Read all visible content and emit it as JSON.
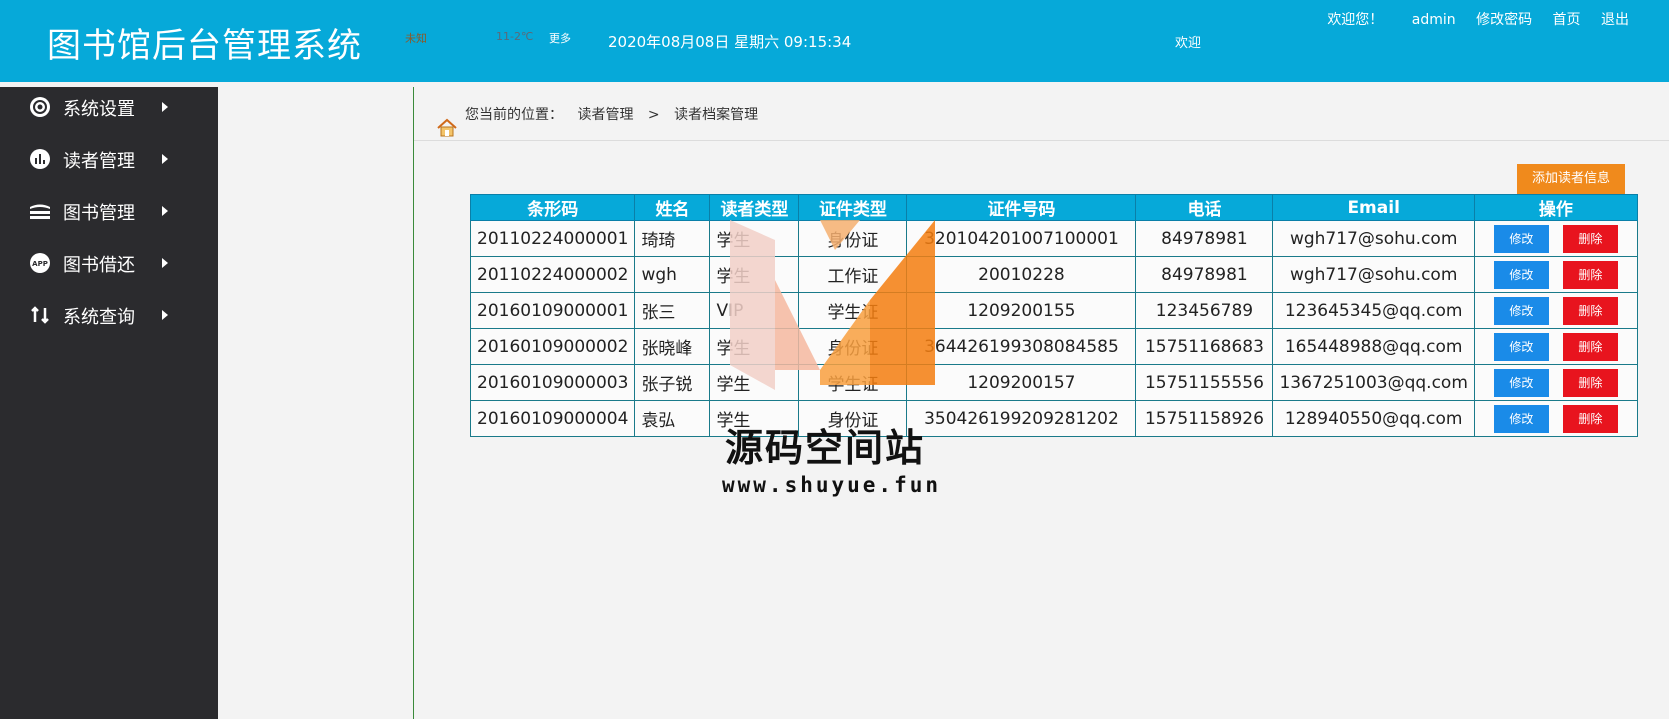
{
  "header": {
    "title": "图书馆后台管理系统",
    "weather": "未知",
    "temperature": "11-2℃",
    "more": "更多",
    "datetime": "2020年08月08日 星期六 09:15:34",
    "mid_text": "欢迎",
    "welcome": "欢迎您！",
    "user": "admin",
    "change_password": "修改密码",
    "home": "首页",
    "logout": "退出"
  },
  "sidebar": {
    "items": [
      {
        "label": "系统设置",
        "icon": "gear-icon"
      },
      {
        "label": "读者管理",
        "icon": "chart-icon"
      },
      {
        "label": "图书管理",
        "icon": "stack-icon"
      },
      {
        "label": "图书借还",
        "icon": "app-icon"
      },
      {
        "label": "系统查询",
        "icon": "swap-icon"
      }
    ]
  },
  "breadcrumb": {
    "prefix": "您当前的位置：",
    "level1": "读者管理",
    "sep": ">",
    "level2": "读者档案管理"
  },
  "add_button": "添加读者信息",
  "table": {
    "headers": [
      "条形码",
      "姓名",
      "读者类型",
      "证件类型",
      "证件号码",
      "电话",
      "Email",
      "操作"
    ],
    "edit_label": "修改",
    "delete_label": "删除",
    "rows": [
      [
        "20110224000001",
        "琦琦",
        "学生",
        "身份证",
        "320104201007100001",
        "84978981",
        "wgh717@sohu.com"
      ],
      [
        "20110224000002",
        "wgh",
        "学生",
        "工作证",
        "20010228",
        "84978981",
        "wgh717@sohu.com"
      ],
      [
        "20160109000001",
        "张三",
        "VIP",
        "学生证",
        "1209200155",
        "123456789",
        "123645345@qq.com"
      ],
      [
        "20160109000002",
        "张晓峰",
        "学生",
        "身份证",
        "364426199308084585",
        "15751168683",
        "165448988@qq.com"
      ],
      [
        "20160109000003",
        "张子锐",
        "学生",
        "学生证",
        "1209200157",
        "15751155556",
        "1367251003@qq.com"
      ],
      [
        "20160109000004",
        "袁弘",
        "学生",
        "身份证",
        "350426199209281202",
        "15751158926",
        "128940550@qq.com"
      ]
    ]
  },
  "watermark": {
    "text": "源码空间站",
    "url": "www.shuyue.fun"
  }
}
